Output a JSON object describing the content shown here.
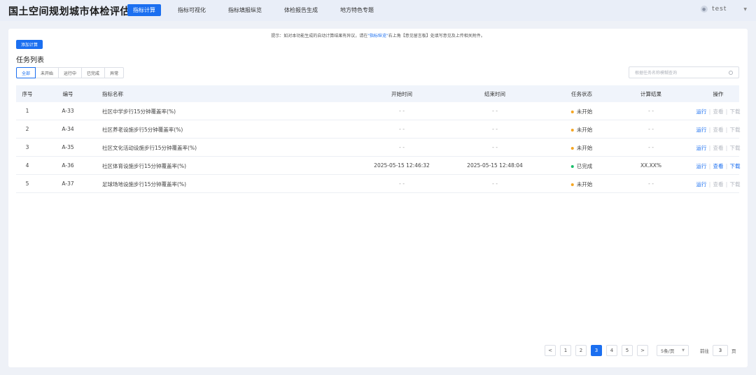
{
  "header": {
    "title": "国土空间规划城市体检评估",
    "nav": [
      "指标计算",
      "指标可视化",
      "指标填报纵览",
      "体检报告生成",
      "地方特色专题"
    ],
    "active_nav": 0,
    "user": "test"
  },
  "hint": {
    "prefix": "提示：如对本功能生成的自动计算结果有异议，请在",
    "link": "\"指标纵览\"",
    "suffix": "右上角【意见留言板】处填写意见及上传相关附件。"
  },
  "add_button": "添加计算",
  "list_title": "任务列表",
  "filters": [
    "全部",
    "未开始",
    "运行中",
    "已完成",
    "异常"
  ],
  "active_filter": 0,
  "search": {
    "placeholder": "根据任务名称模糊查询"
  },
  "table": {
    "columns": [
      "序号",
      "编号",
      "指标名称",
      "开始时间",
      "结束时间",
      "任务状态",
      "计算结果",
      "操作"
    ],
    "rows": [
      {
        "index": "1",
        "code": "A-33",
        "name": "社区中学步行15分钟覆盖率(%)",
        "start": "- -",
        "end": "- -",
        "status": "未开始",
        "result": "- -",
        "ops": [
          "运行",
          "查看",
          "下载"
        ],
        "ops_enabled": [
          true,
          false,
          false
        ]
      },
      {
        "index": "2",
        "code": "A-34",
        "name": "社区养老设施步行5分钟覆盖率(%)",
        "start": "- -",
        "end": "- -",
        "status": "未开始",
        "result": "- -",
        "ops": [
          "运行",
          "查看",
          "下载"
        ],
        "ops_enabled": [
          true,
          false,
          false
        ]
      },
      {
        "index": "3",
        "code": "A-35",
        "name": "社区文化活动设施步行15分钟覆盖率(%)",
        "start": "- -",
        "end": "- -",
        "status": "未开始",
        "result": "- -",
        "ops": [
          "运行",
          "查看",
          "下载"
        ],
        "ops_enabled": [
          true,
          false,
          false
        ]
      },
      {
        "index": "4",
        "code": "A-36",
        "name": "社区体育设施步行15分钟覆盖率(%)",
        "start": "2025-05-15 12:46:32",
        "end": "2025-05-15 12:48:04",
        "status": "已完成",
        "result": "XX.XX%",
        "ops": [
          "运行",
          "查看",
          "下载"
        ],
        "ops_enabled": [
          true,
          true,
          true
        ]
      },
      {
        "index": "5",
        "code": "A-37",
        "name": "足球场地设施步行15分钟覆盖率(%)",
        "start": "- -",
        "end": "- -",
        "status": "未开始",
        "result": "- -",
        "ops": [
          "运行",
          "查看",
          "下载"
        ],
        "ops_enabled": [
          true,
          false,
          false
        ]
      }
    ]
  },
  "status_colors": {
    "未开始": "#f5a623",
    "已完成": "#19be6b"
  },
  "pagination": {
    "prev": "<",
    "next": ">",
    "pages": [
      "1",
      "2",
      "3",
      "4",
      "5"
    ],
    "current": "3",
    "page_size": "5条/页",
    "goto_prefix": "前往",
    "goto_value": "3",
    "goto_suffix": "页"
  }
}
